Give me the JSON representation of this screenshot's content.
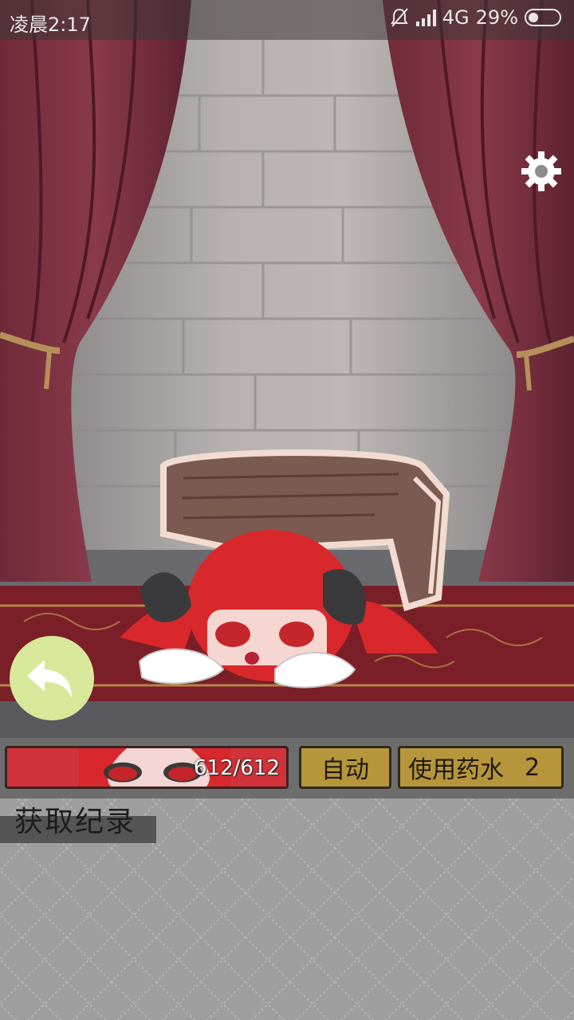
{
  "status_bar": {
    "time": "凌晨2:17",
    "network": "4G",
    "battery_percent": "29%"
  },
  "hud": {
    "hp_text": "612/612",
    "hp_fraction": 1.0,
    "auto_button": "自动",
    "potion_button": "使用药水",
    "potion_count": "2"
  },
  "log": {
    "title": "获取纪录"
  },
  "icons": {
    "settings": "gear-icon",
    "back": "back-arrow-icon",
    "mute": "bell-off-icon",
    "signal": "signal-icon",
    "battery": "battery-icon"
  },
  "colors": {
    "hp_bar": "#d2333a",
    "button_gold": "#b6953b",
    "back_button": "#d8e89a"
  }
}
